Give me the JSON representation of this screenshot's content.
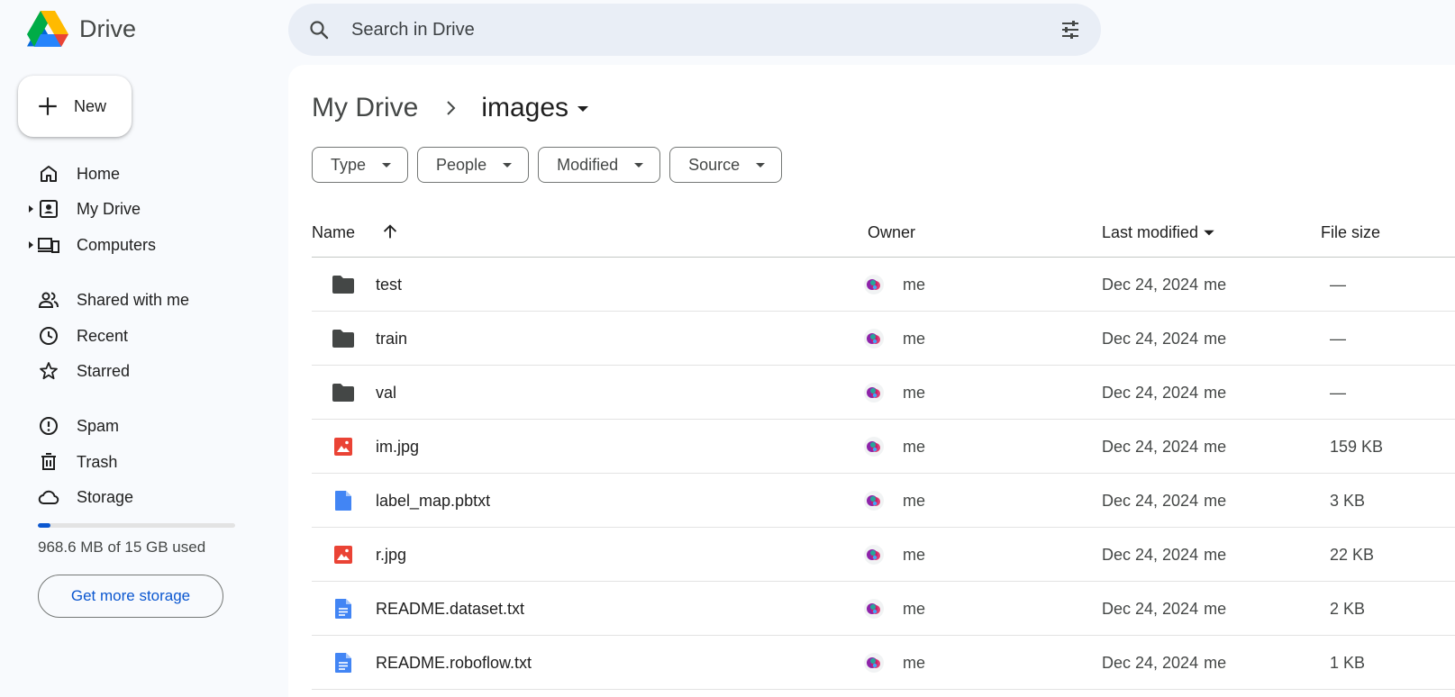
{
  "app": {
    "name": "Drive"
  },
  "search": {
    "placeholder": "Search in Drive"
  },
  "new_button": {
    "label": "New"
  },
  "nav": {
    "home": "Home",
    "my_drive": "My Drive",
    "computers": "Computers",
    "shared": "Shared with me",
    "recent": "Recent",
    "starred": "Starred",
    "spam": "Spam",
    "trash": "Trash",
    "storage": "Storage"
  },
  "storage": {
    "used_text": "968.6 MB of 15 GB used",
    "used_fraction": 0.065,
    "cta": "Get more storage"
  },
  "breadcrumb": {
    "root": "My Drive",
    "current": "images"
  },
  "filters": [
    "Type",
    "People",
    "Modified",
    "Source"
  ],
  "table": {
    "columns": {
      "name": "Name",
      "owner": "Owner",
      "modified": "Last modified",
      "size": "File size"
    },
    "rows": [
      {
        "icon": "folder-icon",
        "name": "test",
        "owner": "me",
        "modified": "Dec 24, 2024",
        "modified_by": "me",
        "size": "—"
      },
      {
        "icon": "folder-icon",
        "name": "train",
        "owner": "me",
        "modified": "Dec 24, 2024",
        "modified_by": "me",
        "size": "—"
      },
      {
        "icon": "folder-icon",
        "name": "val",
        "owner": "me",
        "modified": "Dec 24, 2024",
        "modified_by": "me",
        "size": "—"
      },
      {
        "icon": "image-file-icon",
        "name": "im.jpg",
        "owner": "me",
        "modified": "Dec 24, 2024",
        "modified_by": "me",
        "size": "159 KB"
      },
      {
        "icon": "blank-file-icon",
        "name": "label_map.pbtxt",
        "owner": "me",
        "modified": "Dec 24, 2024",
        "modified_by": "me",
        "size": "3 KB"
      },
      {
        "icon": "image-file-icon",
        "name": "r.jpg",
        "owner": "me",
        "modified": "Dec 24, 2024",
        "modified_by": "me",
        "size": "22 KB"
      },
      {
        "icon": "text-doc-icon",
        "name": "README.dataset.txt",
        "owner": "me",
        "modified": "Dec 24, 2024",
        "modified_by": "me",
        "size": "2 KB"
      },
      {
        "icon": "text-doc-icon",
        "name": "README.roboflow.txt",
        "owner": "me",
        "modified": "Dec 24, 2024",
        "modified_by": "me",
        "size": "1 KB"
      }
    ]
  },
  "colors": {
    "accent": "#0b57d0",
    "folder": "#444746",
    "image_file": "#ea4335",
    "doc_file": "#4285f4"
  }
}
